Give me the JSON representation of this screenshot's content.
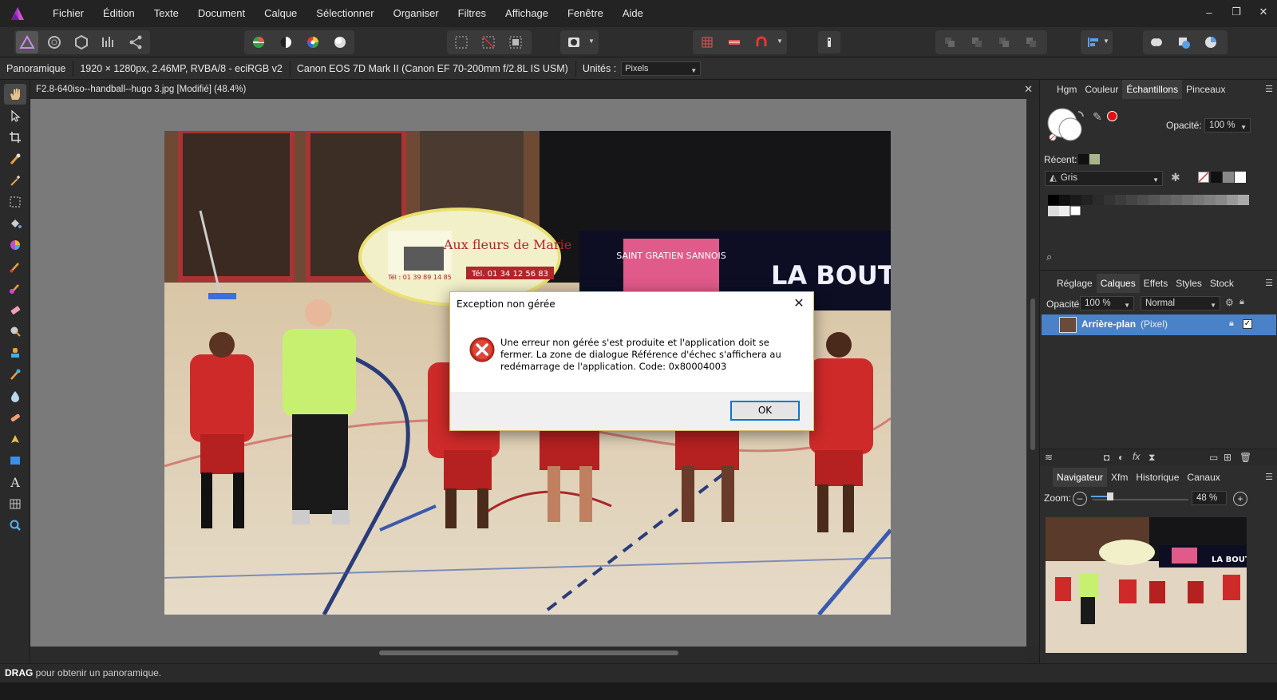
{
  "menu": [
    "Fichier",
    "Édition",
    "Texte",
    "Document",
    "Calque",
    "Sélectionner",
    "Organiser",
    "Filtres",
    "Affichage",
    "Fenêtre",
    "Aide"
  ],
  "window_controls": {
    "minimize": "–",
    "restore": "❐",
    "close": "✕"
  },
  "context": {
    "tool_name": "Panoramique",
    "doc_info": "1920 × 1280px, 2.46MP, RVBA/8 - eciRGB v2",
    "camera": "Canon EOS 7D Mark II (Canon EF 70-200mm f/2.8L IS USM)",
    "units_label": "Unités :",
    "units_value": "Pixels"
  },
  "document": {
    "title": "F2.8-640iso--handball--hugo 3.jpg [Modifié] (48.4%)",
    "close": "✕"
  },
  "photo_text": {
    "banner_brand": "Aux fleurs de Marie",
    "banner_phone": "Tél. 01 34 12 56 83",
    "banner_left_phone": "Tél : 01 39 89 14 85",
    "screen_text": "LA BOUTIQU",
    "club_text": "SAINT GRATIEN SANNOIS"
  },
  "dialog": {
    "title": "Exception non gérée",
    "close": "✕",
    "message": "Une erreur non gérée s'est produite et l'application doit se fermer. La zone de dialogue Référence d'échec s'affichera au redémarrage de l'application. Code: 0x80004003",
    "ok_label": "OK"
  },
  "status": {
    "key": "DRAG",
    "text": " pour obtenir un panoramique."
  },
  "panel_color": {
    "tabs": [
      "Hgm",
      "Couleur",
      "Échantillons",
      "Pinceaux"
    ],
    "active_tab": "Échantillons",
    "opacity_label": "Opacité:",
    "opacity_value": "100 %",
    "recent_label": "Récent:",
    "palette_name": "Gris",
    "accent_red": "#e01010"
  },
  "panel_layers": {
    "tabs": [
      "Réglage",
      "Calques",
      "Effets",
      "Styles",
      "Stock"
    ],
    "active_tab": "Calques",
    "opacity_label": "Opacité:",
    "opacity_value": "100 %",
    "blend_mode": "Normal",
    "layer_name": "Arrière-plan",
    "layer_type": "(Pixel)",
    "selected_color": "#4a82c8"
  },
  "panel_nav": {
    "tabs": [
      "Navigateur",
      "Xfm",
      "Historique",
      "Canaux"
    ],
    "active_tab": "Navigateur",
    "zoom_label": "Zoom:",
    "zoom_value": "48 %",
    "thumb_text": "LA BOUTIQU"
  }
}
